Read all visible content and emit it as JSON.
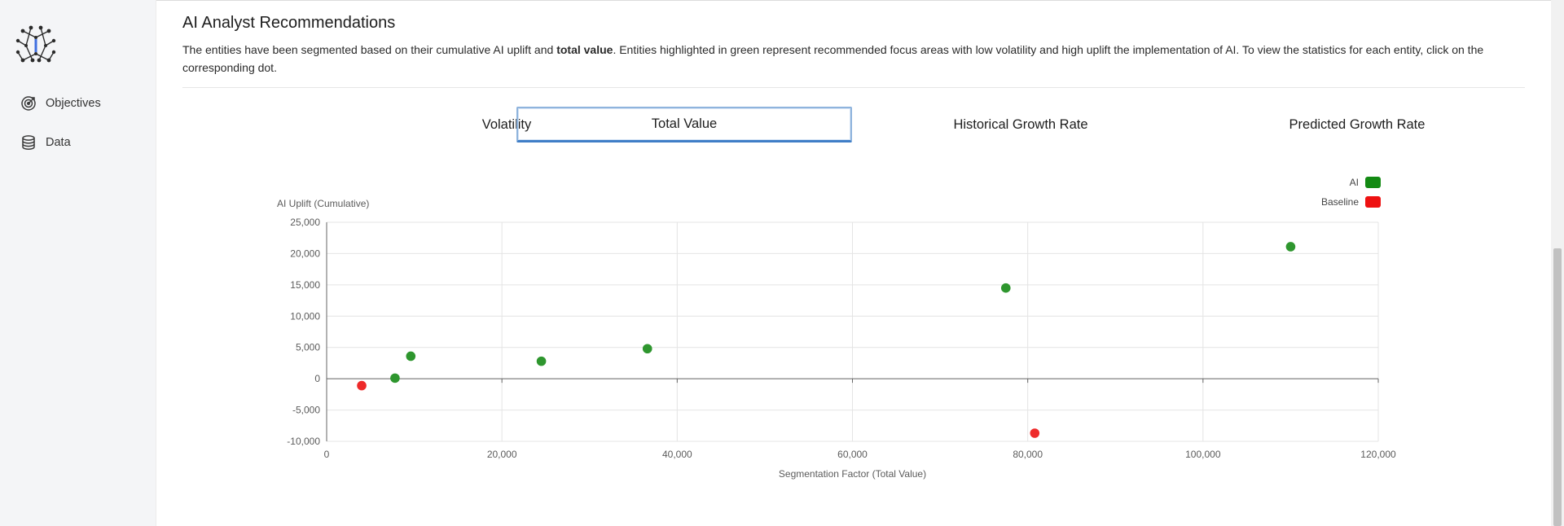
{
  "nav": {
    "items": [
      {
        "label": "Objectives",
        "icon": "target-icon"
      },
      {
        "label": "Data",
        "icon": "database-icon"
      }
    ]
  },
  "section": {
    "title": "AI Analyst Recommendations",
    "desc_pre": "The entities have been segmented based on their cumulative AI uplift and ",
    "desc_bold": "total value",
    "desc_post": ". Entities highlighted in green represent recommended focus areas with low volatility and high uplift the implementation of AI. To view the statistics for each entity, click on the corresponding dot."
  },
  "tabs": [
    {
      "label": "Volatility",
      "active": false
    },
    {
      "label": "Total Value",
      "active": true
    },
    {
      "label": "Historical Growth Rate",
      "active": false
    },
    {
      "label": "Predicted Growth Rate",
      "active": false
    }
  ],
  "colors": {
    "ai": "#2e962e",
    "baseline": "#ee2a2a",
    "legend_ai": "#138a13",
    "legend_baseline": "#ee1111",
    "grid": "#e4e4e4",
    "axis": "#666666",
    "accent": "#3f7ec7"
  },
  "chart_data": {
    "type": "scatter",
    "xlabel": "Segmentation Factor (Total Value)",
    "ylabel": "AI Uplift (Cumulative)",
    "xlim": [
      0,
      120000
    ],
    "ylim": [
      -10000,
      25000
    ],
    "x_ticks": [
      0,
      20000,
      40000,
      60000,
      80000,
      100000,
      120000
    ],
    "y_ticks": [
      -10000,
      -5000,
      0,
      5000,
      10000,
      15000,
      20000,
      25000
    ],
    "grid": true,
    "legend_position": "top-right",
    "legend": [
      {
        "name": "AI",
        "color_key": "legend_ai"
      },
      {
        "name": "Baseline",
        "color_key": "legend_baseline"
      }
    ],
    "points": [
      {
        "x": 4000,
        "y": -1100,
        "group": "baseline"
      },
      {
        "x": 7800,
        "y": 100,
        "group": "ai"
      },
      {
        "x": 9600,
        "y": 3600,
        "group": "ai"
      },
      {
        "x": 24500,
        "y": 2800,
        "group": "ai"
      },
      {
        "x": 36600,
        "y": 4800,
        "group": "ai"
      },
      {
        "x": 77500,
        "y": 14500,
        "group": "ai"
      },
      {
        "x": 80800,
        "y": -8700,
        "group": "baseline"
      },
      {
        "x": 110000,
        "y": 21100,
        "group": "ai"
      }
    ]
  }
}
